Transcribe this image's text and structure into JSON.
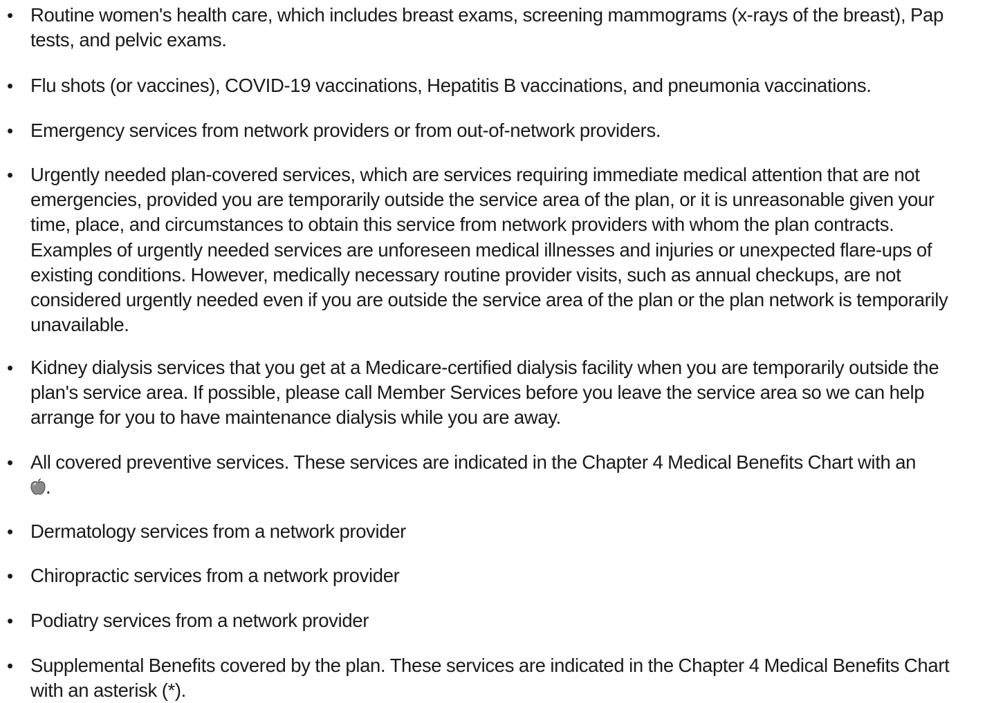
{
  "bullet_char": "•",
  "items": [
    {
      "text": "Routine women's health care, which includes breast exams, screening mammograms (x-rays of the breast), Pap tests, and pelvic exams."
    },
    {
      "text": "Flu shots (or vaccines), COVID-19 vaccinations, Hepatitis B vaccinations, and pneumonia vaccinations."
    },
    {
      "text": "Emergency services from network providers or from out-of-network providers."
    },
    {
      "text": "Urgently needed plan-covered services, which are services requiring immediate medical attention that are not emergencies, provided you are temporarily outside the service area of the plan, or it is unreasonable given your time, place, and circumstances to obtain this service from network providers with whom the plan contracts. Examples of urgently needed services are unforeseen medical illnesses and injuries or unexpected flare-ups of existing conditions. However, medically necessary routine provider visits, such as annual checkups, are not considered urgently needed even if you are outside the service area of the plan or the plan network is temporarily unavailable."
    },
    {
      "text": "Kidney dialysis services that you get at a Medicare-certified dialysis facility when you are temporarily outside the plan's service area. If possible, please call Member Services before you leave the service area so we can help arrange for you to have maintenance dialysis while you are away."
    },
    {
      "text": "All covered preventive services. These services are indicated in the Chapter 4 Medical Benefits Chart with an",
      "icon": "apple-icon",
      "after_icon": "."
    },
    {
      "text": "Dermatology services from a network provider"
    },
    {
      "text": "Chiropractic services from a network provider"
    },
    {
      "text": "Podiatry services from a network provider"
    },
    {
      "text": "Supplemental Benefits covered by the plan. These services are indicated in the Chapter 4 Medical Benefits Chart with an asterisk (*)."
    }
  ]
}
